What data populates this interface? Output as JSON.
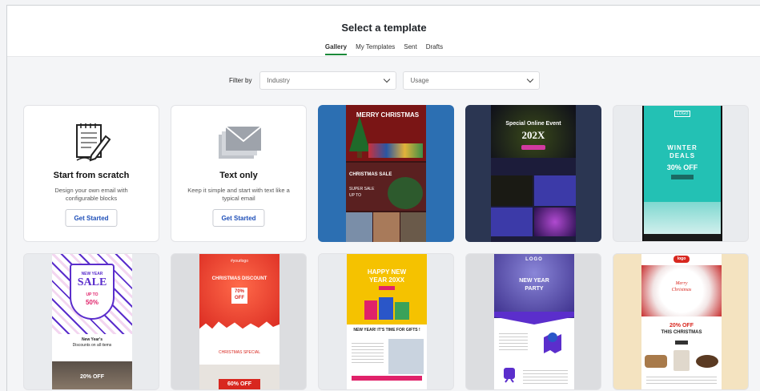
{
  "header": {
    "title": "Select a template",
    "tabs": [
      {
        "label": "Gallery",
        "active": true
      },
      {
        "label": "My Templates"
      },
      {
        "label": "Sent"
      },
      {
        "label": "Drafts"
      }
    ]
  },
  "filter": {
    "label": "Filter by",
    "industry_placeholder": "Industry",
    "usage_placeholder": "Usage"
  },
  "cards": {
    "scratch": {
      "title": "Start from scratch",
      "desc": "Design your own email with configurable blocks",
      "button": "Get Started"
    },
    "text_only": {
      "title": "Text only",
      "desc": "Keep it simple and start with text like a typical email",
      "button": "Get Started"
    }
  },
  "templates": {
    "christmas": {
      "headline": "MERRY CHRISTMAS",
      "line2": "CHRISTMAS SALE",
      "line3": "SUPER SALE",
      "line4": "UP TO"
    },
    "online_event": {
      "headline": "Special Online Event",
      "year": "202X"
    },
    "winter": {
      "logo": "LOGO",
      "line1": "WINTER",
      "line2": "DEALS",
      "line3": "30% OFF"
    },
    "new_year_sale": {
      "line1": "NEW YEAR",
      "line2": "SALE",
      "line3": "UP TO",
      "line4": "50%",
      "line5": "New Year's",
      "line6": "Discounts on all items",
      "badge": "20% OFF"
    },
    "christmas_discount": {
      "logo": "#yourlogo",
      "line1": "CHRISTMAS DISCOUNT",
      "line2": "70%",
      "line3": "OFF",
      "line4": "CHRISTMAS SPECIAL",
      "badge": "60% OFF"
    },
    "happy_new_year": {
      "line1": "HAPPY NEW",
      "line2": "YEAR 20XX",
      "line3": "NEW YEAR! IT'S TIME FOR GIFTS !"
    },
    "new_year_party": {
      "logo": "LOGO",
      "line1": "NEW YEAR",
      "line2": "PARTY"
    },
    "christmas_20off": {
      "logo": "logo",
      "line1": "Merry",
      "line2": "Christmas",
      "line3": "20% OFF",
      "line4": "THIS CHRISTMAS"
    }
  },
  "colors": {
    "accent": "#1b8a3a",
    "link": "#1e4fb8"
  }
}
